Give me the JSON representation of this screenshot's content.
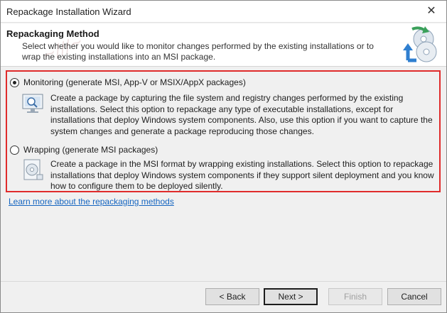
{
  "window": {
    "title": "Repackage Installation Wizard",
    "close_glyph": "✕"
  },
  "header": {
    "title": "Repackaging Method",
    "description": "Select whether you would like to monitor changes performed by the existing installations or to wrap the existing installations into an MSI package.",
    "icon": "repackage-discs-icon"
  },
  "options": [
    {
      "label": "Monitoring (generate MSI, App-V or MSIX/AppX packages)",
      "selected": true,
      "icon": "monitor-magnifier-icon",
      "description": "Create a package by capturing the file system and registry changes performed by the existing installations. Select this option to repackage any type of executable installations, except for installations that deploy Windows system components. Also, use this option if you want to capture the system changes and generate a package reproducing those changes."
    },
    {
      "label": "Wrapping (generate MSI packages)",
      "selected": false,
      "icon": "package-wrap-icon",
      "description": "Create a package in the MSI format by wrapping existing installations. Select this option to repackage installations that deploy Windows system components if they support silent deployment and you know how to configure them to be deployed silently."
    }
  ],
  "link": {
    "text": "Learn more about the repackaging methods"
  },
  "buttons": {
    "back": "< Back",
    "next": "Next >",
    "finish": "Finish",
    "cancel": "Cancel"
  },
  "colors": {
    "highlight_border": "#e02b2b",
    "link": "#1565c0",
    "icon_green": "#3aa05a",
    "icon_blue": "#2f7fd0"
  }
}
